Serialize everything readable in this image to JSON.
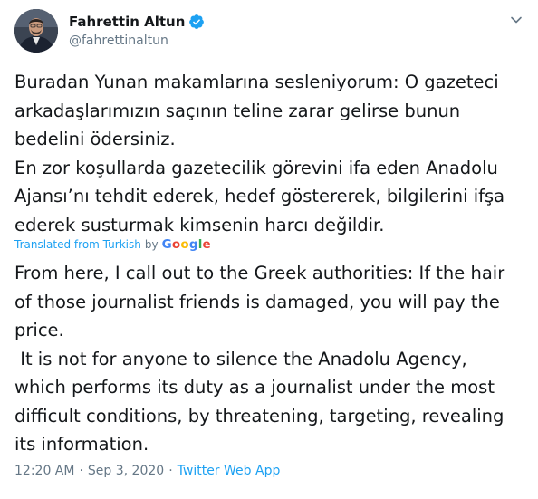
{
  "author": {
    "name": "Fahrettin Altun",
    "handle": "@fahrettinaltun",
    "verified": true
  },
  "tweet": {
    "original_text": "Buradan Yunan makamlarına sesleniyorum: O gazeteci arkadaşlarımızın saçının teline zarar gelirse bunun bedelini ödersiniz.\nEn zor koşullarda gazetecilik görevini ifa eden Anadolu Ajansı’nı tehdit ederek, hedef göstererek, bilgilerini ifşa ederek susturmak kimsenin harcı değildir.",
    "translated_text": "From here, I call out to the Greek authorities: If the hair of those journalist friends is damaged, you will pay the price.\n It is not for anyone to silence the Anadolu Agency, which performs its duty as a journalist under the most difficult conditions, by threatening, targeting, revealing its information."
  },
  "translation": {
    "label": "Translated from Turkish",
    "by": "by",
    "provider": "Google"
  },
  "meta": {
    "time": "12:20 AM",
    "date": "Sep 3, 2020",
    "separator": "·",
    "source": "Twitter Web App"
  },
  "icons": {
    "verified": "verified-badge-icon",
    "caret": "chevron-down-icon"
  },
  "colors": {
    "text": "#14171a",
    "secondary": "#657786",
    "link": "#1da1f2",
    "verified": "#1da1f2",
    "google_blue": "#4285f4",
    "google_red": "#ea4335",
    "google_yellow": "#fbbc05",
    "google_green": "#34a853"
  }
}
